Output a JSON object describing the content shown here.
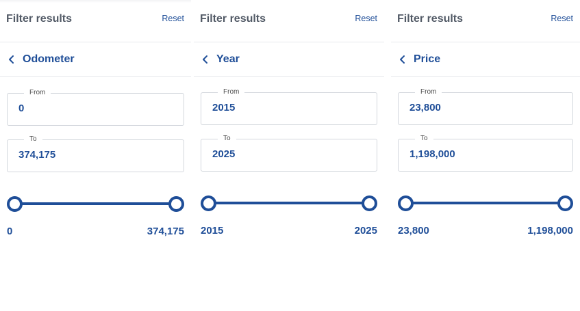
{
  "panels": [
    {
      "header_title": "Filter results",
      "reset_label": "Reset",
      "filter_name": "Odometer",
      "from_label": "From",
      "from_value": "0",
      "to_label": "To",
      "to_value": "374,175",
      "range_min_label": "0",
      "range_max_label": "374,175",
      "slider": {
        "min": 0,
        "max": 374175,
        "low": 0,
        "high": 374175
      }
    },
    {
      "header_title": "Filter results",
      "reset_label": "Reset",
      "filter_name": "Year",
      "from_label": "From",
      "from_value": "2015",
      "to_label": "To",
      "to_value": "2025",
      "range_min_label": "2015",
      "range_max_label": "2025",
      "slider": {
        "min": 2015,
        "max": 2025,
        "low": 2015,
        "high": 2025
      }
    },
    {
      "header_title": "Filter results",
      "reset_label": "Reset",
      "filter_name": "Price",
      "from_label": "From",
      "from_value": "23,800",
      "to_label": "To",
      "to_value": "1,198,000",
      "range_min_label": "23,800",
      "range_max_label": "1,198,000",
      "slider": {
        "min": 23800,
        "max": 1198000,
        "low": 23800,
        "high": 1198000
      }
    }
  ],
  "icons": {
    "back": "chevron-left-icon"
  },
  "colors": {
    "accent": "#1f4e98",
    "header_text": "#525a66",
    "border": "#d2d6dc",
    "divider": "#e6e8ec"
  }
}
